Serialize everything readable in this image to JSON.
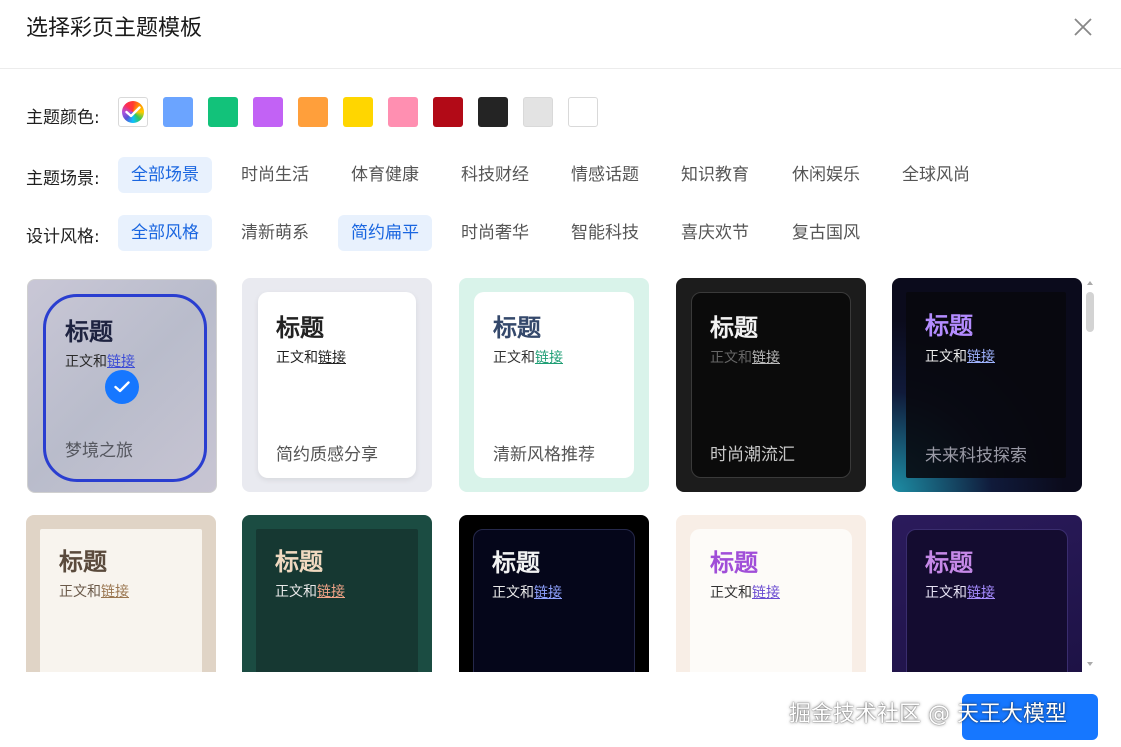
{
  "dialog": {
    "title": "选择彩页主题模板",
    "close_icon": "close-icon"
  },
  "colors": {
    "label": "主题颜色:",
    "swatches": [
      "multicolor",
      "#6ba4ff",
      "#12c27a",
      "#c262f5",
      "#ff9f3b",
      "#ffd600",
      "#ff8fb1",
      "#b20a17",
      "#242424",
      "#e3e3e3",
      "#ffffff"
    ],
    "selected": "multicolor"
  },
  "scenes": {
    "label": "主题场景:",
    "items": [
      "全部场景",
      "时尚生活",
      "体育健康",
      "科技财经",
      "情感话题",
      "知识教育",
      "休闲娱乐",
      "全球风尚"
    ],
    "active": [
      "全部场景"
    ]
  },
  "styles": {
    "label": "设计风格:",
    "items": [
      "全部风格",
      "清新萌系",
      "简约扁平",
      "时尚奢华",
      "智能科技",
      "喜庆欢节",
      "复古国风"
    ],
    "active": [
      "全部风格",
      "简约扁平"
    ]
  },
  "templates": [
    {
      "title": "标题",
      "body": "正文和",
      "link": "链接",
      "footer": "梦境之旅",
      "selected": true
    },
    {
      "title": "标题",
      "body": "正文和",
      "link": "链接",
      "footer": "简约质感分享"
    },
    {
      "title": "标题",
      "body": "正文和",
      "link": "链接",
      "footer": "清新风格推荐"
    },
    {
      "title": "标题",
      "body": "正文和",
      "link": "链接",
      "footer": "时尚潮流汇"
    },
    {
      "title": "标题",
      "body": "正文和",
      "link": "链接",
      "footer": "未来科技探索"
    },
    {
      "title": "标题",
      "body": "正文和",
      "link": "链接",
      "footer": ""
    },
    {
      "title": "标题",
      "body": "正文和",
      "link": "链接",
      "footer": ""
    },
    {
      "title": "标题",
      "body": "正文和",
      "link": "链接",
      "footer": ""
    },
    {
      "title": "标题",
      "body": "正文和",
      "link": "链接",
      "footer": ""
    },
    {
      "title": "标题",
      "body": "正文和",
      "link": "链接",
      "footer": ""
    }
  ],
  "watermark": "掘金技术社区 @ 天王大模型",
  "accent": "#1677ff"
}
